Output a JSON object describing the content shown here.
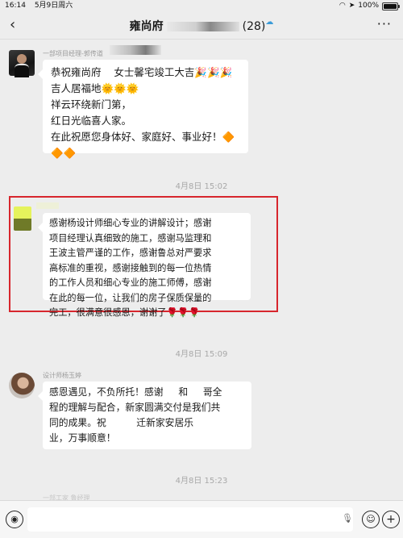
{
  "status": {
    "time": "16:14",
    "date": "5月9日周六",
    "battery": "100%"
  },
  "nav": {
    "back": "‹",
    "title": "雍尚府",
    "count": "(28)",
    "more": "···"
  },
  "messages": [
    {
      "sender": "一部项目经理-郭传道",
      "text": "恭祝雍尚府    女士馨宅竣工大吉🎉🎉🎉\n吉人居福地🌞🌞🌞\n祥云环绕新门第，\n红日光临喜人家。\n在此祝愿您身体好、家庭好、事业好！🔶\n🔶🔶"
    },
    {
      "time": "4月8日 15:02"
    },
    {
      "sender": "",
      "text": "感谢杨设计师细心专业的讲解设计；感谢\n项目经理认真细致的施工，感谢马监理和\n王波主管严谨的工作，感谢鲁总对严要求\n高标准的重视，感谢接触到的每一位热情\n的工作人员和细心专业的施工师傅，感谢\n在此的每一位，让我们的房子保质保量的\n完工，很满意很感恩，谢谢了🌹🌹🌹"
    },
    {
      "time": "4月8日 15:09"
    },
    {
      "sender": "设计师杨玉婷",
      "text": "感恩遇见，不负所托！感谢     和     哥全\n程的理解与配合，新家圆满交付是我们共\n同的成果。祝          迁新家安居乐\n业，万事顺意！"
    },
    {
      "time": "4月8日 15:23"
    },
    {
      "sender": "一部工家  鲁经理"
    }
  ],
  "colors": {
    "highlight": "#d7262d",
    "chat_bg": "#ededed",
    "bubble": "#ffffff"
  },
  "icons": [
    "voice-icon",
    "emoji-icon",
    "plus-icon",
    "mic-icon"
  ]
}
